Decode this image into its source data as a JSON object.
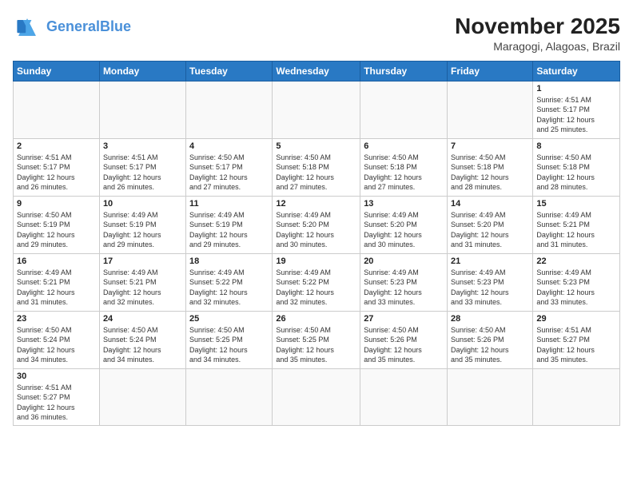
{
  "header": {
    "logo_line1": "General",
    "logo_line2": "Blue",
    "month": "November 2025",
    "location": "Maragogi, Alagoas, Brazil"
  },
  "weekdays": [
    "Sunday",
    "Monday",
    "Tuesday",
    "Wednesday",
    "Thursday",
    "Friday",
    "Saturday"
  ],
  "weeks": [
    [
      {
        "day": "",
        "info": ""
      },
      {
        "day": "",
        "info": ""
      },
      {
        "day": "",
        "info": ""
      },
      {
        "day": "",
        "info": ""
      },
      {
        "day": "",
        "info": ""
      },
      {
        "day": "",
        "info": ""
      },
      {
        "day": "1",
        "info": "Sunrise: 4:51 AM\nSunset: 5:17 PM\nDaylight: 12 hours\nand 25 minutes."
      }
    ],
    [
      {
        "day": "2",
        "info": "Sunrise: 4:51 AM\nSunset: 5:17 PM\nDaylight: 12 hours\nand 26 minutes."
      },
      {
        "day": "3",
        "info": "Sunrise: 4:51 AM\nSunset: 5:17 PM\nDaylight: 12 hours\nand 26 minutes."
      },
      {
        "day": "4",
        "info": "Sunrise: 4:50 AM\nSunset: 5:17 PM\nDaylight: 12 hours\nand 27 minutes."
      },
      {
        "day": "5",
        "info": "Sunrise: 4:50 AM\nSunset: 5:18 PM\nDaylight: 12 hours\nand 27 minutes."
      },
      {
        "day": "6",
        "info": "Sunrise: 4:50 AM\nSunset: 5:18 PM\nDaylight: 12 hours\nand 27 minutes."
      },
      {
        "day": "7",
        "info": "Sunrise: 4:50 AM\nSunset: 5:18 PM\nDaylight: 12 hours\nand 28 minutes."
      },
      {
        "day": "8",
        "info": "Sunrise: 4:50 AM\nSunset: 5:18 PM\nDaylight: 12 hours\nand 28 minutes."
      }
    ],
    [
      {
        "day": "9",
        "info": "Sunrise: 4:50 AM\nSunset: 5:19 PM\nDaylight: 12 hours\nand 29 minutes."
      },
      {
        "day": "10",
        "info": "Sunrise: 4:49 AM\nSunset: 5:19 PM\nDaylight: 12 hours\nand 29 minutes."
      },
      {
        "day": "11",
        "info": "Sunrise: 4:49 AM\nSunset: 5:19 PM\nDaylight: 12 hours\nand 29 minutes."
      },
      {
        "day": "12",
        "info": "Sunrise: 4:49 AM\nSunset: 5:20 PM\nDaylight: 12 hours\nand 30 minutes."
      },
      {
        "day": "13",
        "info": "Sunrise: 4:49 AM\nSunset: 5:20 PM\nDaylight: 12 hours\nand 30 minutes."
      },
      {
        "day": "14",
        "info": "Sunrise: 4:49 AM\nSunset: 5:20 PM\nDaylight: 12 hours\nand 31 minutes."
      },
      {
        "day": "15",
        "info": "Sunrise: 4:49 AM\nSunset: 5:21 PM\nDaylight: 12 hours\nand 31 minutes."
      }
    ],
    [
      {
        "day": "16",
        "info": "Sunrise: 4:49 AM\nSunset: 5:21 PM\nDaylight: 12 hours\nand 31 minutes."
      },
      {
        "day": "17",
        "info": "Sunrise: 4:49 AM\nSunset: 5:21 PM\nDaylight: 12 hours\nand 32 minutes."
      },
      {
        "day": "18",
        "info": "Sunrise: 4:49 AM\nSunset: 5:22 PM\nDaylight: 12 hours\nand 32 minutes."
      },
      {
        "day": "19",
        "info": "Sunrise: 4:49 AM\nSunset: 5:22 PM\nDaylight: 12 hours\nand 32 minutes."
      },
      {
        "day": "20",
        "info": "Sunrise: 4:49 AM\nSunset: 5:23 PM\nDaylight: 12 hours\nand 33 minutes."
      },
      {
        "day": "21",
        "info": "Sunrise: 4:49 AM\nSunset: 5:23 PM\nDaylight: 12 hours\nand 33 minutes."
      },
      {
        "day": "22",
        "info": "Sunrise: 4:49 AM\nSunset: 5:23 PM\nDaylight: 12 hours\nand 33 minutes."
      }
    ],
    [
      {
        "day": "23",
        "info": "Sunrise: 4:50 AM\nSunset: 5:24 PM\nDaylight: 12 hours\nand 34 minutes."
      },
      {
        "day": "24",
        "info": "Sunrise: 4:50 AM\nSunset: 5:24 PM\nDaylight: 12 hours\nand 34 minutes."
      },
      {
        "day": "25",
        "info": "Sunrise: 4:50 AM\nSunset: 5:25 PM\nDaylight: 12 hours\nand 34 minutes."
      },
      {
        "day": "26",
        "info": "Sunrise: 4:50 AM\nSunset: 5:25 PM\nDaylight: 12 hours\nand 35 minutes."
      },
      {
        "day": "27",
        "info": "Sunrise: 4:50 AM\nSunset: 5:26 PM\nDaylight: 12 hours\nand 35 minutes."
      },
      {
        "day": "28",
        "info": "Sunrise: 4:50 AM\nSunset: 5:26 PM\nDaylight: 12 hours\nand 35 minutes."
      },
      {
        "day": "29",
        "info": "Sunrise: 4:51 AM\nSunset: 5:27 PM\nDaylight: 12 hours\nand 35 minutes."
      }
    ],
    [
      {
        "day": "30",
        "info": "Sunrise: 4:51 AM\nSunset: 5:27 PM\nDaylight: 12 hours\nand 36 minutes."
      },
      {
        "day": "",
        "info": ""
      },
      {
        "day": "",
        "info": ""
      },
      {
        "day": "",
        "info": ""
      },
      {
        "day": "",
        "info": ""
      },
      {
        "day": "",
        "info": ""
      },
      {
        "day": "",
        "info": ""
      }
    ]
  ]
}
